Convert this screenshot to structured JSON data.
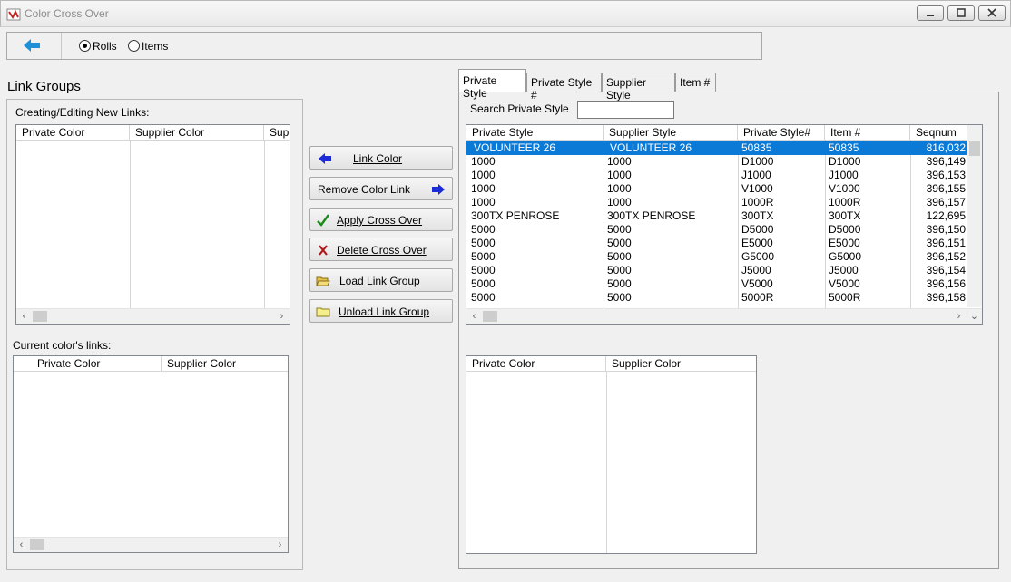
{
  "window": {
    "title": "Color Cross Over"
  },
  "toolbar": {
    "rolls_label": "Rolls",
    "items_label": "Items",
    "selected": "Rolls"
  },
  "left": {
    "title": "Link Groups",
    "creating_label": "Creating/Editing New Links:",
    "creating_columns": [
      "Private Color",
      "Supplier Color",
      "Supp"
    ],
    "current_label": "Current color's links:",
    "current_columns": [
      "Private Color",
      "Supplier Color"
    ]
  },
  "buttons": {
    "link_color": "Link Color",
    "remove_color_link": "Remove Color Link",
    "apply_cross_over": "Apply Cross Over",
    "delete_cross_over": "Delete Cross Over",
    "load_link_group": "Load Link Group",
    "unload_link_group": "Unload Link Group"
  },
  "tabs": [
    "Private Style",
    "Private Style #",
    "Supplier Style",
    "Item #"
  ],
  "search": {
    "label": "Search Private Style",
    "value": ""
  },
  "style_grid": {
    "columns": [
      "Private Style",
      "Supplier Style",
      "Private Style#",
      "Item #",
      "Seqnum"
    ],
    "rows": [
      [
        "VOLUNTEER 26",
        "VOLUNTEER 26",
        "50835",
        "50835",
        "816,032"
      ],
      [
        "1000",
        "1000",
        "D1000",
        "D1000",
        "396,149"
      ],
      [
        "1000",
        "1000",
        "J1000",
        "J1000",
        "396,153"
      ],
      [
        "1000",
        "1000",
        "V1000",
        "V1000",
        "396,155"
      ],
      [
        "1000",
        "1000",
        "1000R",
        "1000R",
        "396,157"
      ],
      [
        "300TX PENROSE",
        "300TX PENROSE",
        "300TX",
        "300TX",
        "122,695"
      ],
      [
        "5000",
        "5000",
        "D5000",
        "D5000",
        "396,150"
      ],
      [
        "5000",
        "5000",
        "E5000",
        "E5000",
        "396,151"
      ],
      [
        "5000",
        "5000",
        "G5000",
        "G5000",
        "396,152"
      ],
      [
        "5000",
        "5000",
        "J5000",
        "J5000",
        "396,154"
      ],
      [
        "5000",
        "5000",
        "V5000",
        "V5000",
        "396,156"
      ],
      [
        "5000",
        "5000",
        "5000R",
        "5000R",
        "396,158"
      ]
    ],
    "selected_row": 0
  },
  "color_grid": {
    "columns": [
      "Private Color",
      "Supplier Color"
    ]
  },
  "colors": {
    "selection": "#0a7ad6",
    "back_arrow": "#1e90d8",
    "link_arrow": "#1b2bd6",
    "check": "#1a8a1a",
    "delete_x": "#b01818"
  },
  "icons": {
    "back": "left-arrow-icon",
    "link": "blue-left-arrow-icon",
    "remove": "blue-right-arrow-icon",
    "apply": "green-check-icon",
    "delete": "red-x-icon",
    "load": "open-folder-icon",
    "unload": "folder-icon"
  }
}
